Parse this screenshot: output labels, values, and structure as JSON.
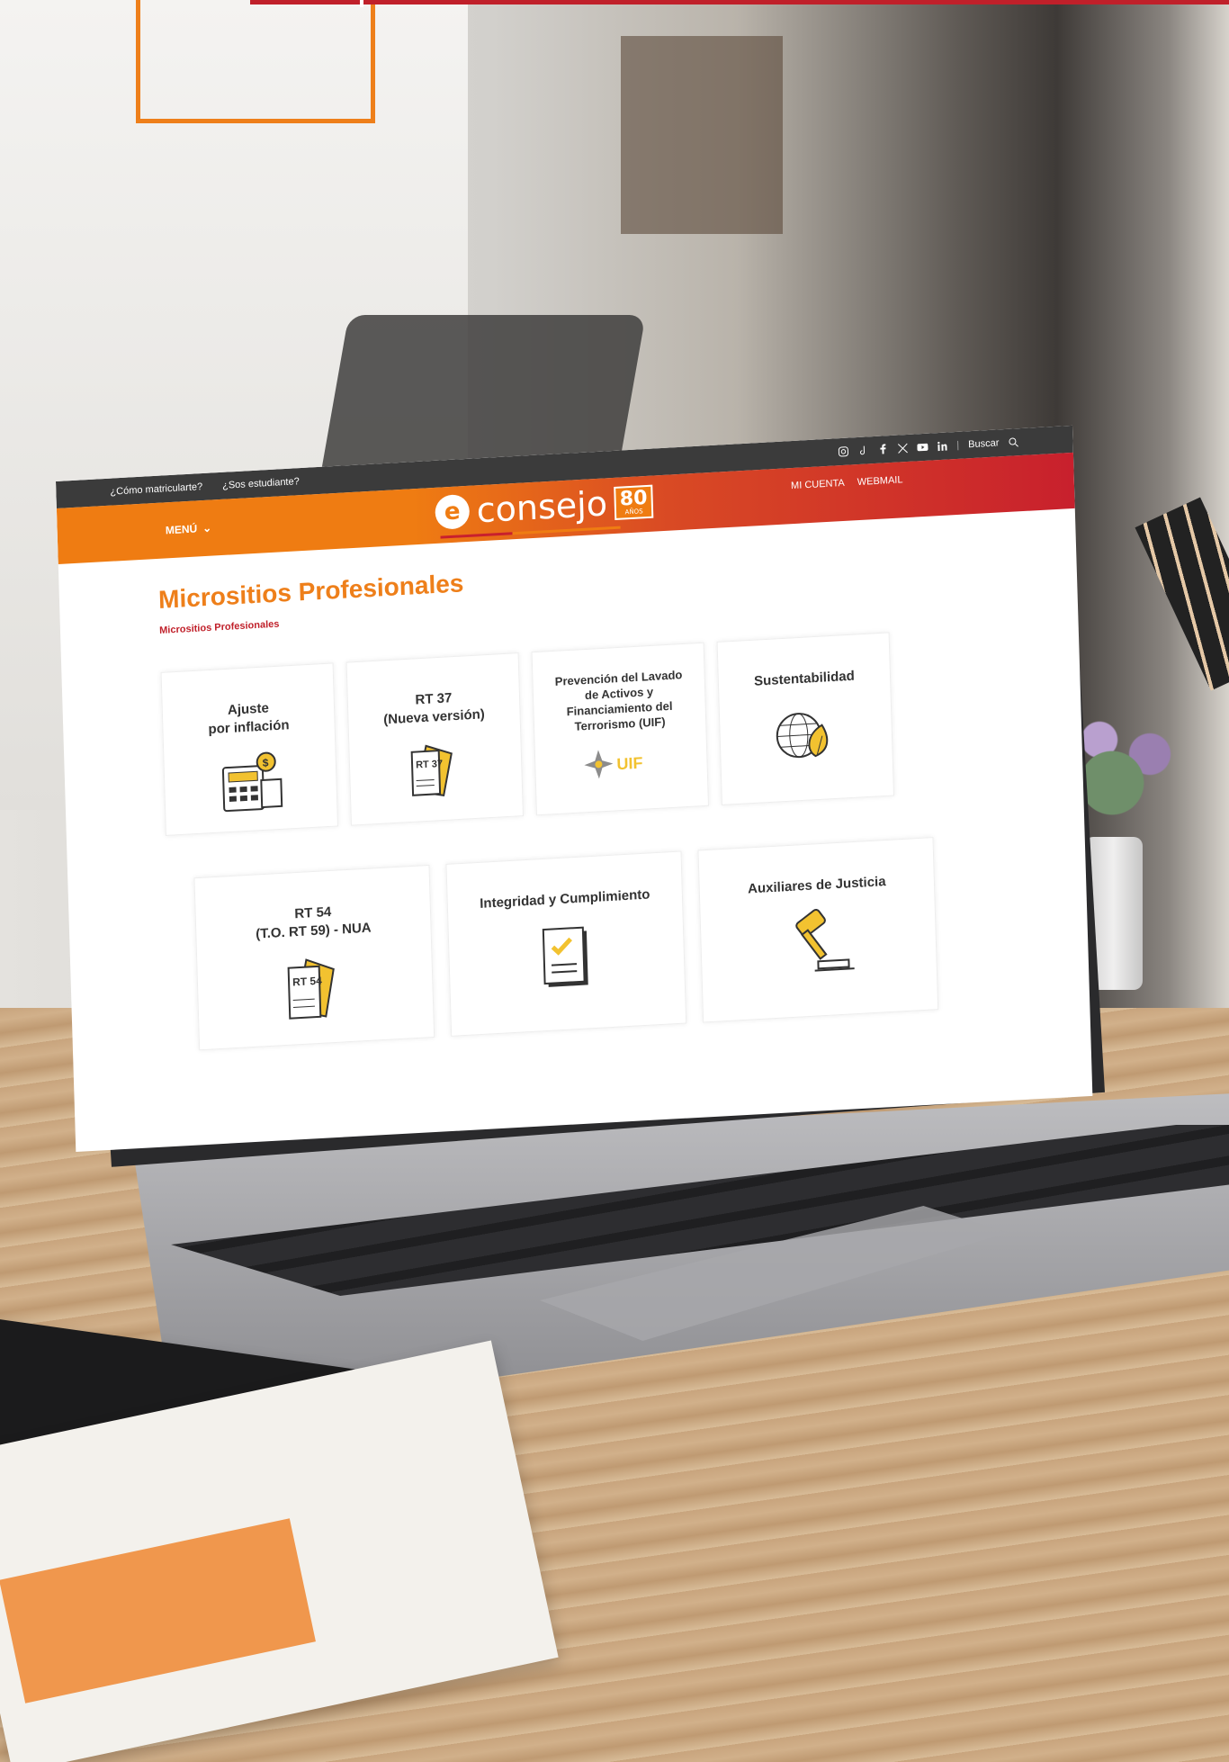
{
  "website": {
    "topbar": {
      "links": [
        "¿Cómo matricularte?",
        "¿Sos estudiante?"
      ],
      "search_label": "Buscar"
    },
    "header": {
      "menu_label": "MENÚ",
      "logo_text": "consejo",
      "logo_badge": "80",
      "logo_badge_sub": "AÑOS",
      "account_links": [
        "MI CUENTA",
        "WEBMAIL"
      ]
    },
    "page": {
      "title": "Micrositios Profesionales",
      "breadcrumb": "Micrositios Profesionales"
    },
    "cards_row1": [
      {
        "label_1": "Ajuste",
        "label_2": "por inflación",
        "icon": "calculator-icon"
      },
      {
        "label_1": "RT 37",
        "label_2": "(Nueva versión)",
        "icon": "notebook-rt37-icon",
        "icon_text": "RT 37"
      },
      {
        "label_1": "Prevención del Lavado",
        "label_2": "de Activos y",
        "label_3": "Financiamiento del",
        "label_4": "Terrorismo (UIF)",
        "icon": "uif-star-icon",
        "icon_text": "UIF"
      },
      {
        "label_1": "Sustentabilidad",
        "icon": "globe-leaf-icon"
      }
    ],
    "cards_row2": [
      {
        "label_1": "RT 54",
        "label_2": "(T.O. RT 59) - NUA",
        "icon": "notebook-rt54-icon",
        "icon_text": "RT 54"
      },
      {
        "label_1": "Integridad y Cumplimiento",
        "icon": "checklist-icon"
      },
      {
        "label_1": "Auxiliares de Justicia",
        "icon": "gavel-icon"
      }
    ]
  },
  "colors": {
    "brand_orange": "#ee7f1a",
    "brand_red": "#c0202a",
    "icon_yellow": "#f2c230"
  }
}
